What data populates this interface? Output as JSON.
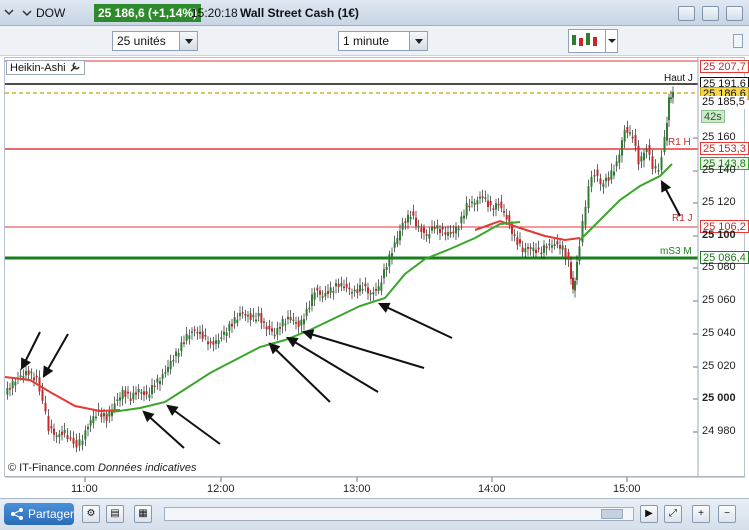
{
  "titlebar": {
    "instrument": "DOW",
    "price_change": "25 186,6 (+1,14%)",
    "time": "15:20:18",
    "name": "Wall Street Cash (1€)"
  },
  "toolbar": {
    "units_value": "25 unités",
    "interval_value": "1 minute"
  },
  "indicator": {
    "label": "Heikin-Ashi"
  },
  "price_tags": {
    "top": "25 207,7",
    "haut_label": "Haut J",
    "haut_value": "25 191,6",
    "current": "25 186,6",
    "pos_value": "25 185,5",
    "countdown": "42s",
    "r1h_label": "R1 H",
    "r1h_value": "25 153,3",
    "ma_value": "25 143,8",
    "r1j_label": "R1 J",
    "r1j_value": "25 106,2",
    "ms3_label": "mS3 M",
    "ms3_value": "25 086,4"
  },
  "axis": {
    "y_labels": [
      "25 160",
      "25 140",
      "25 120",
      "25 100",
      "25 080",
      "25 060",
      "25 040",
      "25 020",
      "25 000",
      "24 980"
    ],
    "x_labels": [
      "11:00",
      "12:00",
      "13:00",
      "14:00",
      "15:00"
    ]
  },
  "watermark": {
    "copyright": "© IT-Finance.com",
    "note": "Données indicatives"
  },
  "bottombar": {
    "share_label": "Partager"
  },
  "colors": {
    "up": "#2e7d32",
    "down": "#c62828",
    "ma_green": "#3aa52a",
    "ma_red": "#e53935",
    "resistance": "#e53935",
    "support": "#1b7d1b"
  }
}
